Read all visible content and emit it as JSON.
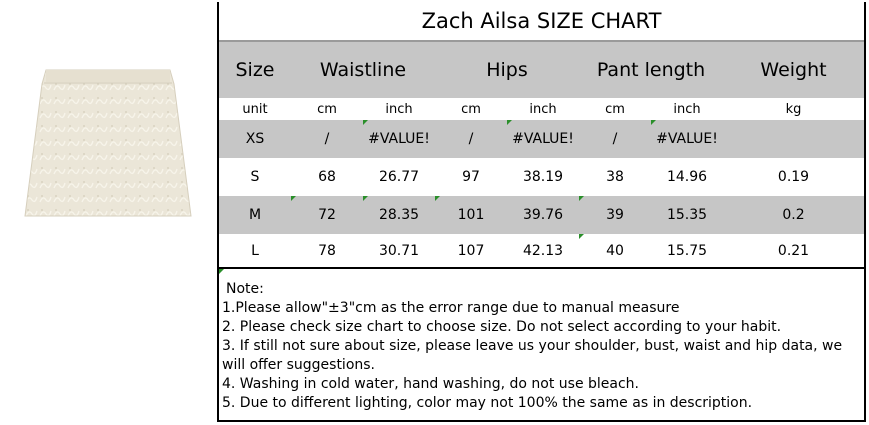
{
  "title": "Zach Ailsa SIZE CHART",
  "headers": {
    "size": "Size",
    "waistline": "Waistline",
    "hips": "Hips",
    "pant_length": "Pant length",
    "weight": "Weight"
  },
  "units": [
    "unit",
    "cm",
    "inch",
    "cm",
    "inch",
    "cm",
    "inch",
    "kg"
  ],
  "rows": [
    [
      "XS",
      "/",
      "#VALUE!",
      "/",
      "#VALUE!",
      "/",
      "#VALUE!",
      ""
    ],
    [
      "S",
      "68",
      "26.77",
      "97",
      "38.19",
      "38",
      "14.96",
      "0.19"
    ],
    [
      "M",
      "72",
      "28.35",
      "101",
      "39.76",
      "39",
      "15.35",
      "0.2"
    ],
    [
      "L",
      "78",
      "30.71",
      "107",
      "42.13",
      "40",
      "15.75",
      "0.21"
    ]
  ],
  "notes": {
    "title": "Note:",
    "lines": [
      "1.Please allow\"±3\"cm as the error range due to manual measure",
      "2. Please check size chart to choose size. Do not select according to your habit.",
      "3. If still not sure about size, please leave us your shoulder, bust, waist and hip data, we will offer suggestions.",
      "4. Washing in cold water, hand washing, do not use bleach.",
      "5. Due to different lighting, color may not 100% the same as in description."
    ]
  },
  "colors": {
    "header_gray": "#c6c6c6",
    "border": "#000000",
    "skirt": "#e9e4d6"
  }
}
